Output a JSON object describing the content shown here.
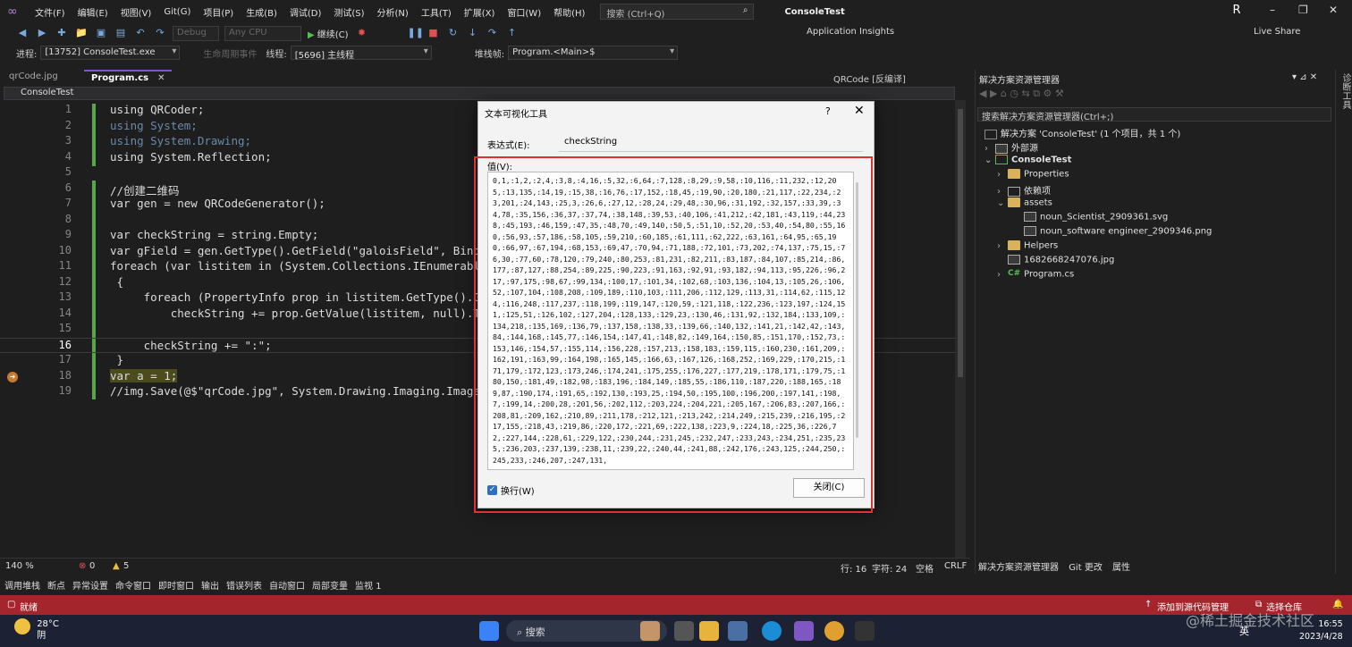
{
  "menubar": {
    "items": [
      "文件(F)",
      "编辑(E)",
      "视图(V)",
      "Git(G)",
      "项目(P)",
      "生成(B)",
      "调试(D)",
      "测试(S)",
      "分析(N)",
      "工具(T)",
      "扩展(X)",
      "窗口(W)",
      "帮助(H)"
    ],
    "search_placeholder": "搜索 (Ctrl+Q)",
    "title": "ConsoleTest",
    "avatar": "R"
  },
  "toolbar": {
    "config": "Debug",
    "platform": "Any CPU",
    "run_label": "继续(C)",
    "app_insights": "Application Insights",
    "live_share": "Live Share"
  },
  "toolbar2": {
    "process_label": "进程:",
    "process_value": "[13752] ConsoleTest.exe",
    "lifecycle": "生命周期事件",
    "thread_label": "线程:",
    "thread_value": "[5696] 主线程",
    "stack_label": "堆栈帧:",
    "stack_value": "Program.<Main>$"
  },
  "tabs": {
    "tab1": "qrCode.jpg",
    "tab2": "Program.cs",
    "qrcode_tab": "QRCode [反编译]",
    "nav": "ConsoleTest"
  },
  "code": {
    "lines": [
      {
        "n": "1",
        "t": "using QRCoder;"
      },
      {
        "n": "2",
        "t": "using System;"
      },
      {
        "n": "3",
        "t": "using System.Drawing;"
      },
      {
        "n": "4",
        "t": "using System.Reflection;"
      },
      {
        "n": "5",
        "t": ""
      },
      {
        "n": "6",
        "t": "//创建二维码"
      },
      {
        "n": "7",
        "t": "var gen = new QRCodeGenerator();"
      },
      {
        "n": "8",
        "t": ""
      },
      {
        "n": "9",
        "t": "var checkString = string.Empty;"
      },
      {
        "n": "10",
        "t": "var gField = gen.GetType().GetField(\"galoisField\", Bindin"
      },
      {
        "n": "11",
        "t": "foreach (var listitem in (System.Collections.IEnumerable)"
      },
      {
        "n": "12",
        "t": " {"
      },
      {
        "n": "13",
        "t": "     foreach (PropertyInfo prop in listitem.GetType().GetP"
      },
      {
        "n": "14",
        "t": "         checkString += prop.GetValue(listitem, null).ToSt"
      },
      {
        "n": "15",
        "t": ""
      },
      {
        "n": "16",
        "t": "     checkString += \":\";"
      },
      {
        "n": "17",
        "t": " }"
      },
      {
        "n": "18",
        "t": "var a = 1;"
      },
      {
        "n": "19",
        "t": "//img.Save(@$\"qrCode.jpg\", System.Drawing.Imaging.ImageFo"
      }
    ]
  },
  "editor_status": {
    "zoom": "140 %",
    "errors": "0",
    "warnings": "5",
    "row": "行: 16",
    "col": "字符: 24",
    "space": "空格",
    "crlf": "CRLF"
  },
  "bottom_tabs": [
    "调用堆栈",
    "断点",
    "异常设置",
    "命令窗口",
    "即时窗口",
    "输出",
    "错误列表",
    "自动窗口",
    "局部变量",
    "监视 1"
  ],
  "statusbar": {
    "ready": "就绪",
    "add_source": "添加到源代码管理",
    "select_repo": "选择仓库"
  },
  "taskbar": {
    "temp": "28°C",
    "weather": "阴",
    "search": "搜索",
    "time": "16:55",
    "date": "2023/4/28",
    "watermark": "@稀土掘金技术社区",
    "lang": "英"
  },
  "solution": {
    "title": "解决方案资源管理器",
    "search": "搜索解决方案资源管理器(Ctrl+;)",
    "items": [
      {
        "label": "解决方案 'ConsoleTest' (1 个项目，共 1 个)"
      },
      {
        "label": "外部源"
      },
      {
        "label": "ConsoleTest"
      },
      {
        "label": "Properties"
      },
      {
        "label": "依赖项"
      },
      {
        "label": "assets"
      },
      {
        "label": "noun_Scientist_2909361.svg"
      },
      {
        "label": "noun_software engineer_2909346.png"
      },
      {
        "label": "Helpers"
      },
      {
        "label": "1682668247076.jpg"
      },
      {
        "label": "Program.cs"
      }
    ],
    "tabs": [
      "解决方案资源管理器",
      "Git 更改",
      "属性"
    ],
    "rail": "诊断工具"
  },
  "dialog": {
    "title": "文本可视化工具",
    "help": "?",
    "expr_label": "表达式(E):",
    "expr_value": "checkString",
    "value_label": "值(V):",
    "value_text": "0,1,:1,2,:2,4,:3,8,:4,16,:5,32,:6,64,:7,128,:8,29,:9,58,:10,116,:11,232,:12,205,:13,135,:14,19,:15,38,:16,76,:17,152,:18,45,:19,90,:20,180,:21,117,:22,234,:23,201,:24,143,:25,3,:26,6,:27,12,:28,24,:29,48,:30,96,:31,192,:32,157,:33,39,:34,78,:35,156,:36,37,:37,74,:38,148,:39,53,:40,106,:41,212,:42,181,:43,119,:44,238,:45,193,:46,159,:47,35,:48,70,:49,140,:50,5,:51,10,:52,20,:53,40,:54,80,:55,160,:56,93,:57,186,:58,105,:59,210,:60,185,:61,111,:62,222,:63,161,:64,95,:65,190,:66,97,:67,194,:68,153,:69,47,:70,94,:71,188,:72,101,:73,202,:74,137,:75,15,:76,30,:77,60,:78,120,:79,240,:80,253,:81,231,:82,211,:83,187,:84,107,:85,214,:86,177,:87,127,:88,254,:89,225,:90,223,:91,163,:92,91,:93,182,:94,113,:95,226,:96,217,:97,175,:98,67,:99,134,:100,17,:101,34,:102,68,:103,136,:104,13,:105,26,:106,52,:107,104,:108,208,:109,189,:110,103,:111,206,:112,129,:113,31,:114,62,:115,124,:116,248,:117,237,:118,199,:119,147,:120,59,:121,118,:122,236,:123,197,:124,151,:125,51,:126,102,:127,204,:128,133,:129,23,:130,46,:131,92,:132,184,:133,109,:134,218,:135,169,:136,79,:137,158,:138,33,:139,66,:140,132,:141,21,:142,42,:143,84,:144,168,:145,77,:146,154,:147,41,:148,82,:149,164,:150,85,:151,170,:152,73,:153,146,:154,57,:155,114,:156,228,:157,213,:158,183,:159,115,:160,230,:161,209,:162,191,:163,99,:164,198,:165,145,:166,63,:167,126,:168,252,:169,229,:170,215,:171,179,:172,123,:173,246,:174,241,:175,255,:176,227,:177,219,:178,171,:179,75,:180,150,:181,49,:182,98,:183,196,:184,149,:185,55,:186,110,:187,220,:188,165,:189,87,:190,174,:191,65,:192,130,:193,25,:194,50,:195,100,:196,200,:197,141,:198,7,:199,14,:200,28,:201,56,:202,112,:203,224,:204,221,:205,167,:206,83,:207,166,:208,81,:209,162,:210,89,:211,178,:212,121,:213,242,:214,249,:215,239,:216,195,:217,155,:218,43,:219,86,:220,172,:221,69,:222,138,:223,9,:224,18,:225,36,:226,72,:227,144,:228,61,:229,122,:230,244,:231,245,:232,247,:233,243,:234,251,:235,235,:236,203,:237,139,:238,11,:239,22,:240,44,:241,88,:242,176,:243,125,:244,250,:245,233,:246,207,:247,131,",
    "wrap_label": "换行(W)",
    "close_label": "关闭(C)"
  },
  "colors": {
    "accent": "#7e57c2",
    "status_bar": "#a4262c",
    "highlight_box": "#e03030"
  }
}
